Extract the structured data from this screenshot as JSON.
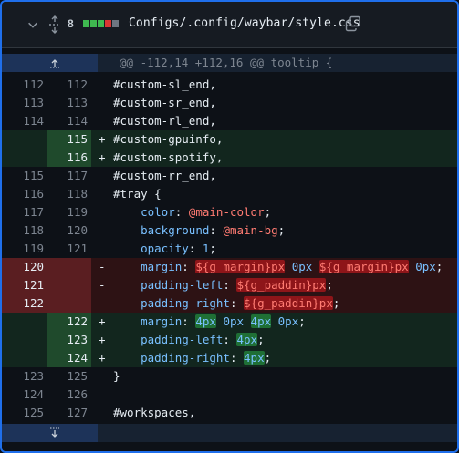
{
  "header": {
    "changes_count": "8",
    "diffstat": [
      "#3fb950",
      "#3fb950",
      "#3fb950",
      "#da3633",
      "#6e7681"
    ],
    "file_path": "Configs/.config/waybar/style.css"
  },
  "hunk_header": "@@ -112,14 +112,16 @@ tooltip {",
  "rows": [
    {
      "type": "ctx",
      "old": "112",
      "new": "112",
      "sign": "",
      "code": "#custom-sl_end,"
    },
    {
      "type": "ctx",
      "old": "113",
      "new": "113",
      "sign": "",
      "code": "#custom-sr_end,"
    },
    {
      "type": "ctx",
      "old": "114",
      "new": "114",
      "sign": "",
      "code": "#custom-rl_end,"
    },
    {
      "type": "add",
      "old": "",
      "new": "115",
      "sign": "+",
      "code": "#custom-gpuinfo,"
    },
    {
      "type": "add",
      "old": "",
      "new": "116",
      "sign": "+",
      "code": "#custom-spotify,"
    },
    {
      "type": "ctx",
      "old": "115",
      "new": "117",
      "sign": "",
      "code": "#custom-rr_end,"
    },
    {
      "type": "ctx",
      "old": "116",
      "new": "118",
      "sign": "",
      "code": "#tray {"
    },
    {
      "type": "ctx",
      "old": "117",
      "new": "119",
      "sign": "",
      "code": "    color: @main-color;"
    },
    {
      "type": "ctx",
      "old": "118",
      "new": "120",
      "sign": "",
      "code": "    background: @main-bg;"
    },
    {
      "type": "ctx",
      "old": "119",
      "new": "121",
      "sign": "",
      "code": "    opacity: 1;"
    },
    {
      "type": "del",
      "old": "120",
      "new": "",
      "sign": "-",
      "code": "    margin: ${g_margin}px 0px ${g_margin}px 0px;"
    },
    {
      "type": "del",
      "old": "121",
      "new": "",
      "sign": "-",
      "code": "    padding-left: ${g_paddin}px;"
    },
    {
      "type": "del",
      "old": "122",
      "new": "",
      "sign": "-",
      "code": "    padding-right: ${g_paddin}px;"
    },
    {
      "type": "add",
      "old": "",
      "new": "122",
      "sign": "+",
      "code": "    margin: 4px 0px 4px 0px;"
    },
    {
      "type": "add",
      "old": "",
      "new": "123",
      "sign": "+",
      "code": "    padding-left: 4px;"
    },
    {
      "type": "add",
      "old": "",
      "new": "124",
      "sign": "+",
      "code": "    padding-right: 4px;"
    },
    {
      "type": "ctx",
      "old": "123",
      "new": "125",
      "sign": "",
      "code": "}"
    },
    {
      "type": "ctx",
      "old": "124",
      "new": "126",
      "sign": "",
      "code": ""
    },
    {
      "type": "ctx",
      "old": "125",
      "new": "127",
      "sign": "",
      "code": "#workspaces,"
    }
  ]
}
